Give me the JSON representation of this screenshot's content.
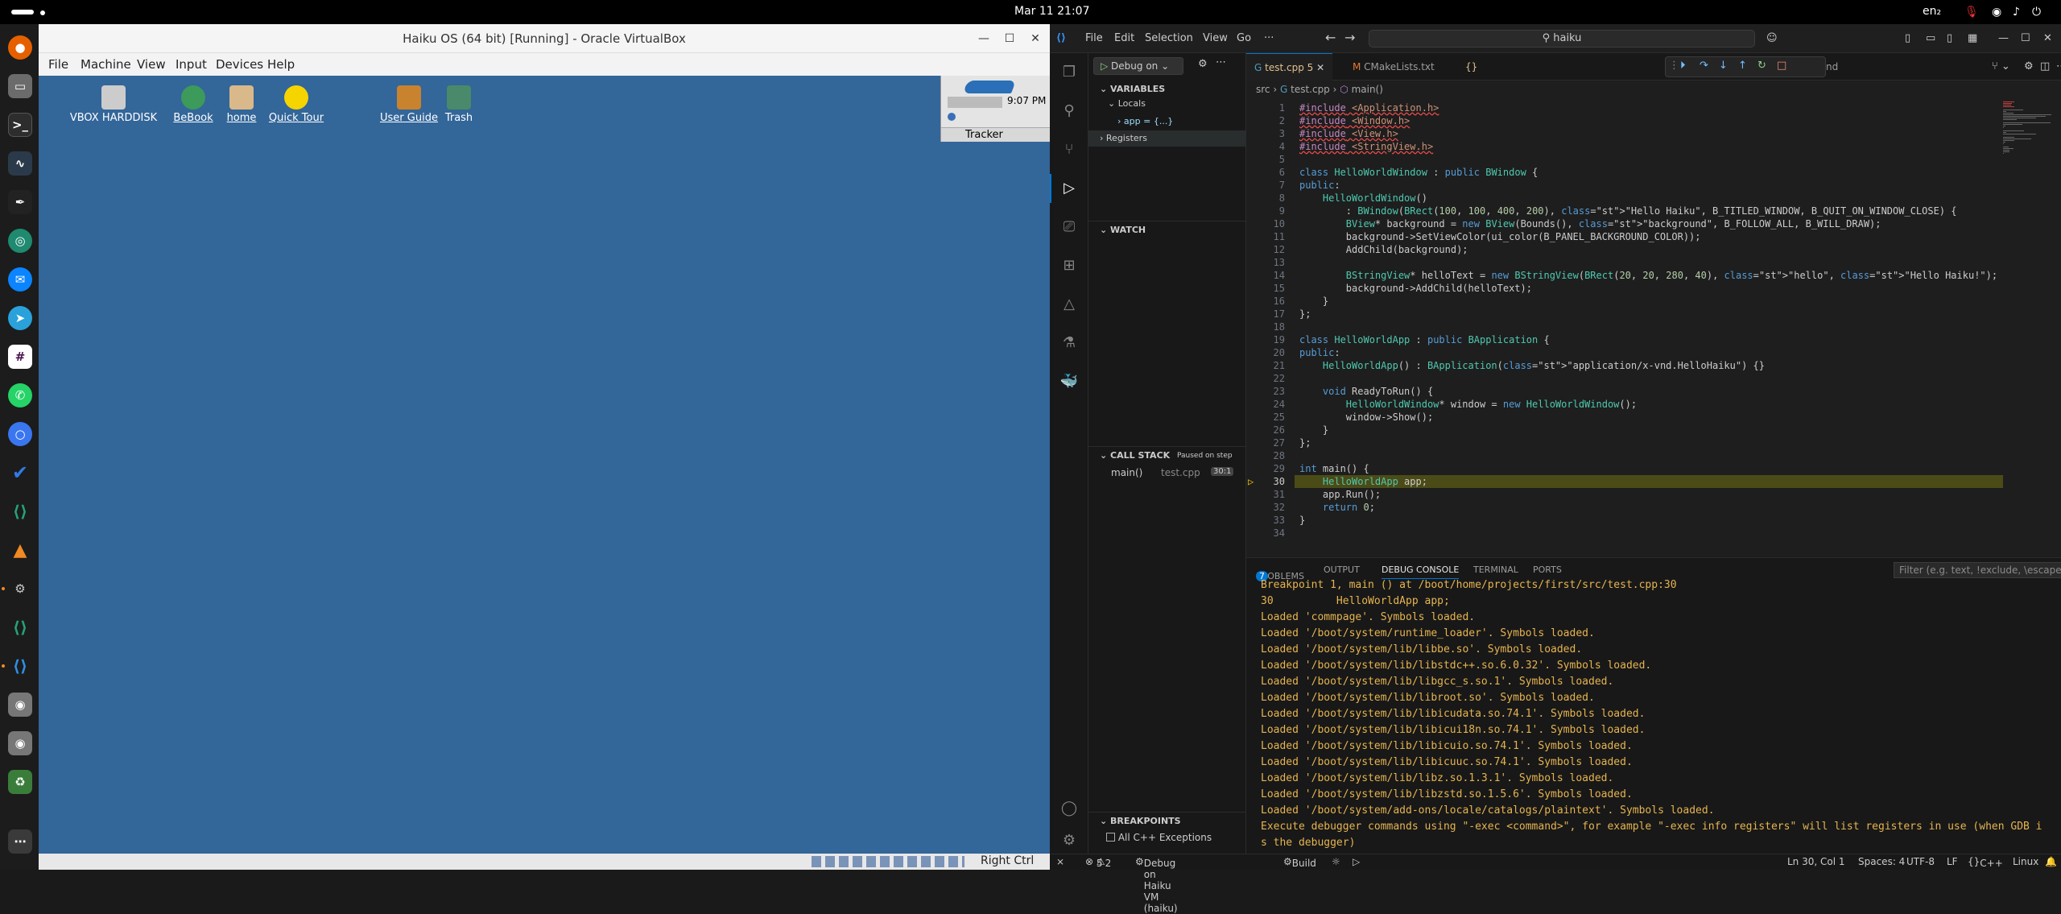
{
  "topbar": {
    "clock": "Mar 11  21:07",
    "lang": "en₂"
  },
  "dock": {
    "items": [
      "firefox-icon",
      "files-icon",
      "terminal-icon",
      "system-monitor-icon",
      "inkscape-icon",
      "chromium-icon",
      "thunderbird-icon",
      "telegram-icon",
      "slack-icon",
      "whatsapp-icon",
      "signal-icon",
      "tasks-icon",
      "vscode-insiders-icon",
      "vlc-icon",
      "virtualbox-icon",
      "vscode-insiders-icon",
      "vscode-icon",
      "disk-icon",
      "disk-icon",
      "trash-icon",
      "show-apps-icon"
    ]
  },
  "vbox": {
    "title": "Haiku OS (64 bit) [Running] - Oracle VirtualBox",
    "menu": [
      "File",
      "Machine",
      "View",
      "Input",
      "Devices",
      "Help"
    ],
    "desktop_icons": [
      {
        "label": "VBOX HARDDISK",
        "underline": false
      },
      {
        "label": "BeBook",
        "underline": true
      },
      {
        "label": "home",
        "underline": true
      },
      {
        "label": "Quick Tour",
        "underline": true
      },
      {
        "label": "User Guide",
        "underline": true
      },
      {
        "label": "Trash",
        "underline": false
      }
    ],
    "deskbar_time": "9:07 PM",
    "deskbar_tracker": "Tracker",
    "status_right": "Right Ctrl"
  },
  "vscode": {
    "menu": [
      "File",
      "Edit",
      "Selection",
      "View",
      "Go",
      "···"
    ],
    "search": "haiku",
    "debug_config": "Debug on",
    "sections": {
      "variables": "VARIABLES",
      "locals": "Locals",
      "app_var": "app = {...}",
      "registers": "Registers",
      "watch": "WATCH",
      "call_stack": "CALL STACK",
      "paused": "Paused on step",
      "frame_fn": "main()",
      "frame_file": "test.cpp",
      "frame_line": "30:1",
      "breakpoints": "BREAKPOINTS",
      "cpp_exceptions": "All C++ Exceptions"
    },
    "tabs": [
      {
        "label": "test.cpp",
        "badge": "5",
        "active": true
      },
      {
        "label": "CMakeLists.txt",
        "active": false
      },
      {
        "label": "nd",
        "active": false
      }
    ],
    "breadcrumb": {
      "folder": "src",
      "file": "test.cpp",
      "symbol": "main()"
    },
    "code_lines": [
      "#include <Application.h>",
      "#include <Window.h>",
      "#include <View.h>",
      "#include <StringView.h>",
      "",
      "class HelloWorldWindow : public BWindow {",
      "public:",
      "    HelloWorldWindow()",
      "        : BWindow(BRect(100, 100, 400, 200), \"Hello Haiku\", B_TITLED_WINDOW, B_QUIT_ON_WINDOW_CLOSE) {",
      "        BView* background = new BView(Bounds(), \"background\", B_FOLLOW_ALL, B_WILL_DRAW);",
      "        background->SetViewColor(ui_color(B_PANEL_BACKGROUND_COLOR));",
      "        AddChild(background);",
      "",
      "        BStringView* helloText = new BStringView(BRect(20, 20, 280, 40), \"hello\", \"Hello Haiku!\");",
      "        background->AddChild(helloText);",
      "    }",
      "};",
      "",
      "class HelloWorldApp : public BApplication {",
      "public:",
      "    HelloWorldApp() : BApplication(\"application/x-vnd.HelloHaiku\") {}",
      "",
      "    void ReadyToRun() {",
      "        HelloWorldWindow* window = new HelloWorldWindow();",
      "        window->Show();",
      "    }",
      "};",
      "",
      "int main() {",
      "    HelloWorldApp app;",
      "    app.Run();",
      "    return 0;",
      "}",
      ""
    ],
    "current_line": 30,
    "panel_tabs": [
      "PROBLEMS",
      "OUTPUT",
      "DEBUG CONSOLE",
      "TERMINAL",
      "PORTS"
    ],
    "problems_count": "7",
    "filter_placeholder": "Filter (e.g. text, !exclude, \\escape)",
    "console_lines": [
      "Breakpoint 1, main () at /boot/home/projects/first/src/test.cpp:30",
      "30          HelloWorldApp app;",
      "Loaded 'commpage'. Symbols loaded.",
      "Loaded '/boot/system/runtime_loader'. Symbols loaded.",
      "Loaded '/boot/system/lib/libbe.so'. Symbols loaded.",
      "Loaded '/boot/system/lib/libstdc++.so.6.0.32'. Symbols loaded.",
      "Loaded '/boot/system/lib/libgcc_s.so.1'. Symbols loaded.",
      "Loaded '/boot/system/lib/libroot.so'. Symbols loaded.",
      "Loaded '/boot/system/lib/libicudata.so.74.1'. Symbols loaded.",
      "Loaded '/boot/system/lib/libicui18n.so.74.1'. Symbols loaded.",
      "Loaded '/boot/system/lib/libicuio.so.74.1'. Symbols loaded.",
      "Loaded '/boot/system/lib/libicuuc.so.74.1'. Symbols loaded.",
      "Loaded '/boot/system/lib/libz.so.1.3.1'. Symbols loaded.",
      "Loaded '/boot/system/lib/libzstd.so.1.5.6'. Symbols loaded.",
      "Loaded '/boot/system/add-ons/locale/catalogs/plaintext'. Symbols loaded.",
      "Execute debugger commands using \"-exec <command>\", for example \"-exec info registers\" will list registers in use (when GDB i",
      "s the debugger)"
    ],
    "status": {
      "errors": "5",
      "warnings": "2",
      "debug": "Debug on Haiku VM (haiku)",
      "build": "Build",
      "position": "Ln 30, Col 1",
      "spaces": "Spaces: 4",
      "encoding": "UTF-8",
      "eol": "LF",
      "language": "C++",
      "platform": "Linux"
    },
    "colors": {
      "accent": "#0078d4",
      "highlight": "#4b4b18",
      "console": "#e6b450"
    }
  }
}
